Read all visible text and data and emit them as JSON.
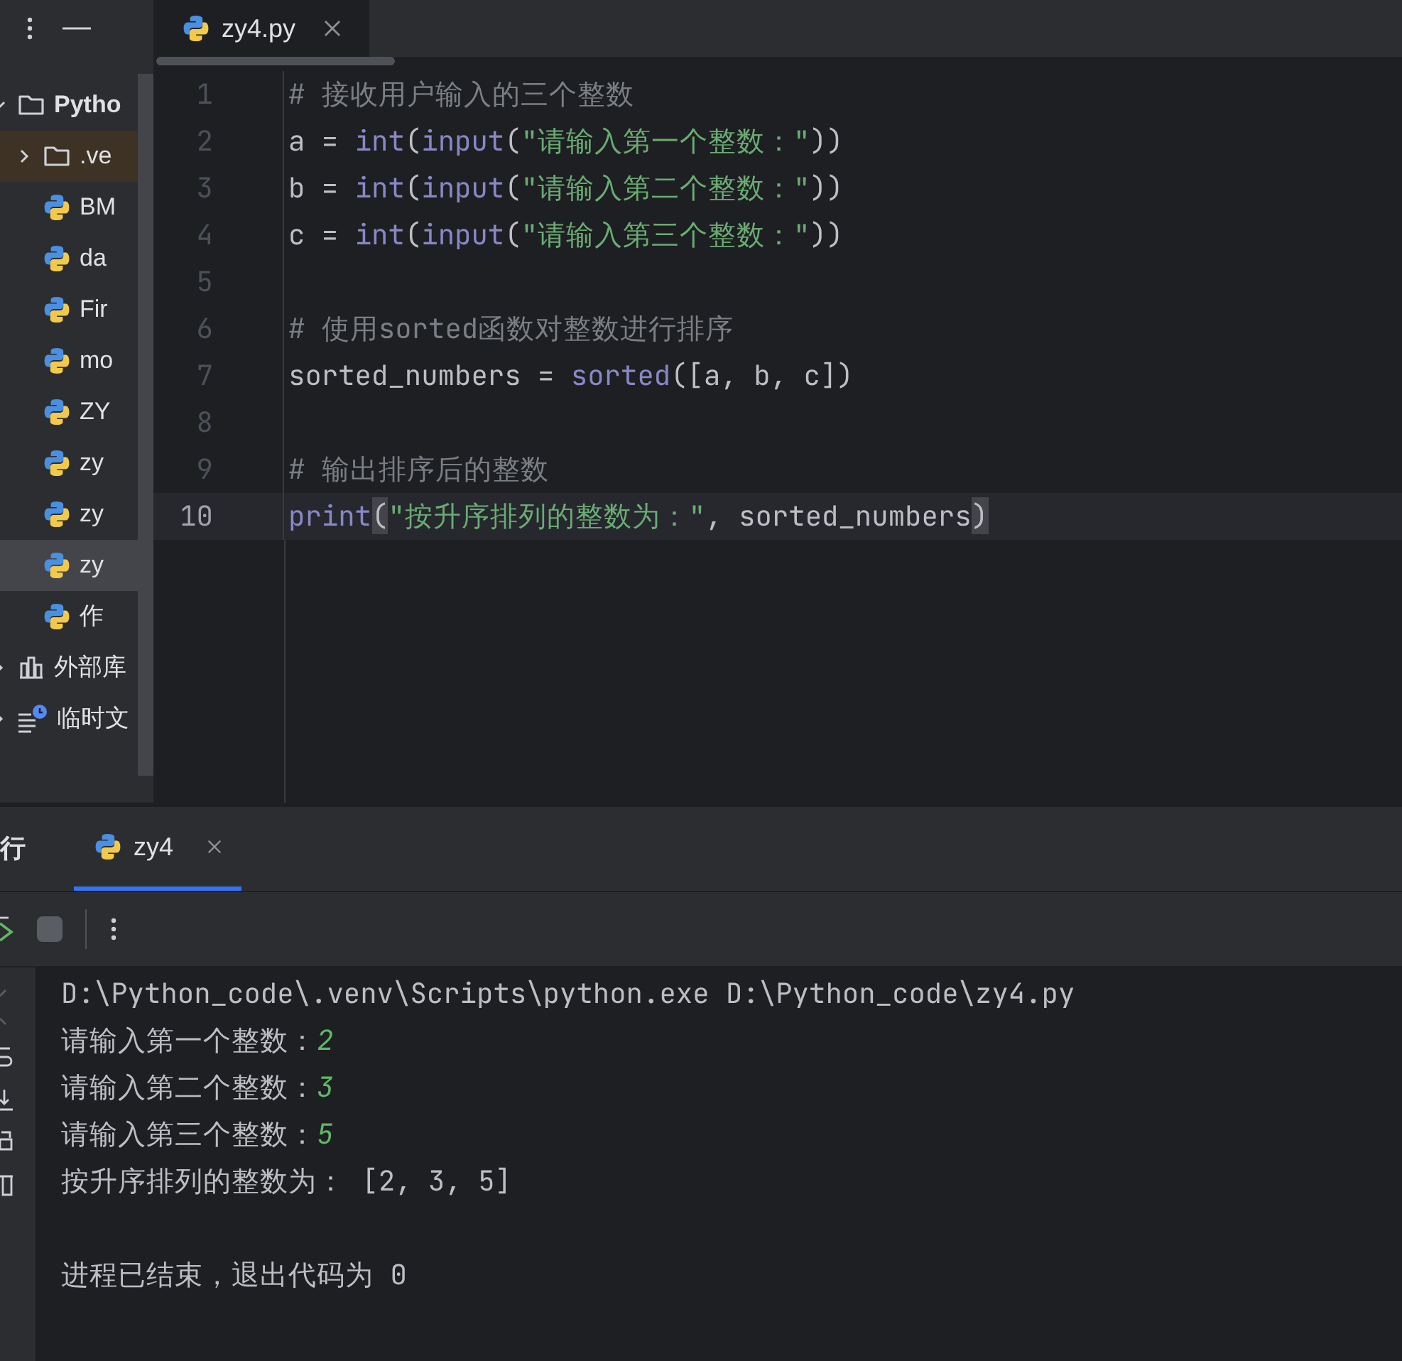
{
  "editor_tabs": [
    {
      "label": "zy4.py",
      "selected": true
    }
  ],
  "project_tree": [
    {
      "kind": "folder",
      "label": "Pytho",
      "expanded": true,
      "selected": false,
      "children": [
        {
          "kind": "folder",
          "label": ".ve",
          "expanded": false,
          "selected": false
        },
        {
          "kind": "python",
          "label": "BM",
          "selected": false
        },
        {
          "kind": "python",
          "label": "da",
          "selected": false
        },
        {
          "kind": "python",
          "label": "Fir",
          "selected": false
        },
        {
          "kind": "python",
          "label": "mo",
          "selected": false
        },
        {
          "kind": "python",
          "label": "ZY",
          "selected": false
        },
        {
          "kind": "python",
          "label": "zy",
          "selected": false
        },
        {
          "kind": "python",
          "label": "zy",
          "selected": false
        },
        {
          "kind": "python",
          "label": "zy",
          "selected": true
        },
        {
          "kind": "python",
          "label": "作",
          "selected": false
        }
      ]
    },
    {
      "kind": "library",
      "label": "外部库",
      "expanded": false,
      "selected": false
    },
    {
      "kind": "scratch",
      "label": "临时文",
      "expanded": false,
      "selected": false
    }
  ],
  "code_lines": [
    {
      "number": "1",
      "current": false,
      "tokens": [
        {
          "kind": "comment",
          "text": "# 接收用户输入的三个整数"
        }
      ]
    },
    {
      "number": "2",
      "current": false,
      "tokens": [
        {
          "kind": "plain",
          "text": "a = "
        },
        {
          "kind": "builtin",
          "text": "int"
        },
        {
          "kind": "plain",
          "text": "("
        },
        {
          "kind": "builtin",
          "text": "input"
        },
        {
          "kind": "plain",
          "text": "("
        },
        {
          "kind": "string",
          "text": "\"请输入第一个整数：\""
        },
        {
          "kind": "plain",
          "text": "))"
        }
      ]
    },
    {
      "number": "3",
      "current": false,
      "tokens": [
        {
          "kind": "plain",
          "text": "b = "
        },
        {
          "kind": "builtin",
          "text": "int"
        },
        {
          "kind": "plain",
          "text": "("
        },
        {
          "kind": "builtin",
          "text": "input"
        },
        {
          "kind": "plain",
          "text": "("
        },
        {
          "kind": "string",
          "text": "\"请输入第二个整数：\""
        },
        {
          "kind": "plain",
          "text": "))"
        }
      ]
    },
    {
      "number": "4",
      "current": false,
      "tokens": [
        {
          "kind": "plain",
          "text": "c = "
        },
        {
          "kind": "builtin",
          "text": "int"
        },
        {
          "kind": "plain",
          "text": "("
        },
        {
          "kind": "builtin",
          "text": "input"
        },
        {
          "kind": "plain",
          "text": "("
        },
        {
          "kind": "string",
          "text": "\"请输入第三个整数：\""
        },
        {
          "kind": "plain",
          "text": "))"
        }
      ]
    },
    {
      "number": "5",
      "current": false
    },
    {
      "number": "6",
      "current": false,
      "tokens": [
        {
          "kind": "comment",
          "text": "# 使用sorted函数对整数进行排序"
        }
      ]
    },
    {
      "number": "7",
      "current": false,
      "tokens": [
        {
          "kind": "plain",
          "text": "sorted_numbers = "
        },
        {
          "kind": "builtin",
          "text": "sorted"
        },
        {
          "kind": "plain",
          "text": "([a, b, c])"
        }
      ]
    },
    {
      "number": "8",
      "current": false
    },
    {
      "number": "9",
      "current": false,
      "tokens": [
        {
          "kind": "comment",
          "text": "# 输出排序后的整数"
        }
      ]
    },
    {
      "number": "10",
      "current": true,
      "tokens": [
        {
          "kind": "builtin",
          "text": "print"
        },
        {
          "kind": "match",
          "text": "("
        },
        {
          "kind": "string",
          "text": "\"按升序排列的整数为：\""
        },
        {
          "kind": "plain",
          "text": ", sorted_numbers"
        },
        {
          "kind": "match",
          "text": ")"
        }
      ]
    }
  ],
  "run_panel": {
    "title": "行",
    "tabs": [
      {
        "label": "zy4",
        "selected": true
      }
    ],
    "console_lines": [
      {
        "parts": [
          {
            "kind": "output",
            "text": "D:\\Python_code\\.venv\\Scripts\\python.exe D:\\Python_code\\zy4.py"
          }
        ]
      },
      {
        "parts": [
          {
            "kind": "output",
            "text": "请输入第一个整数："
          },
          {
            "kind": "input",
            "text": "2"
          }
        ]
      },
      {
        "parts": [
          {
            "kind": "output",
            "text": "请输入第二个整数："
          },
          {
            "kind": "input",
            "text": "3"
          }
        ]
      },
      {
        "parts": [
          {
            "kind": "output",
            "text": "请输入第三个整数："
          },
          {
            "kind": "input",
            "text": "5"
          }
        ]
      },
      {
        "parts": [
          {
            "kind": "output",
            "text": "按升序排列的整数为： [2, 3, 5]"
          }
        ]
      },
      {
        "kind": "exit_status",
        "parts": [
          {
            "kind": "output",
            "text": "进程已结束，退出代码为 0"
          }
        ]
      }
    ]
  }
}
